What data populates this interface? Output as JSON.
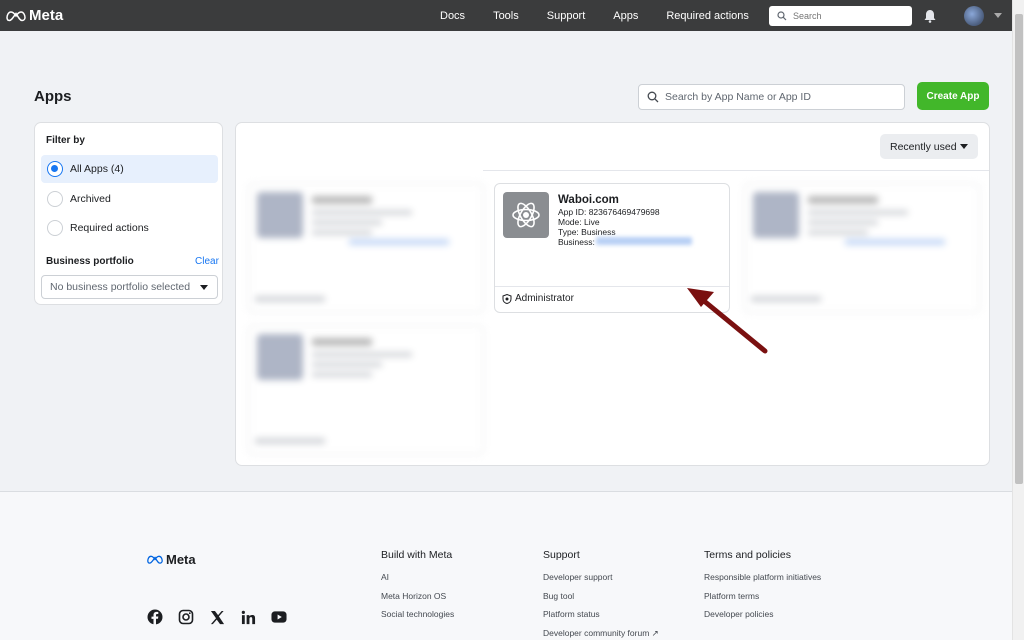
{
  "nav": {
    "brand": "Meta",
    "links": [
      "Docs",
      "Tools",
      "Support",
      "Apps",
      "Required actions"
    ],
    "search_placeholder": "Search"
  },
  "page": {
    "title": "Apps",
    "search_placeholder": "Search by App Name or App ID",
    "create_label": "Create App"
  },
  "filter": {
    "title": "Filter by",
    "options": [
      {
        "label": "All Apps (4)",
        "selected": true
      },
      {
        "label": "Archived",
        "selected": false
      },
      {
        "label": "Required actions",
        "selected": false
      }
    ],
    "portfolio_label": "Business portfolio",
    "clear_label": "Clear",
    "portfolio_value": "No business portfolio selected"
  },
  "apps": {
    "sort_label": "Recently used",
    "featured": {
      "name": "Waboi.com",
      "app_id": "App ID: 823676469479698",
      "mode": "Mode: Live",
      "type": "Type: Business",
      "business": "Business:",
      "role": "Administrator"
    }
  },
  "footer": {
    "brand": "Meta",
    "columns": [
      {
        "title": "Build with Meta",
        "links": [
          "AI",
          "Meta Horizon OS",
          "Social technologies"
        ]
      },
      {
        "title": "Support",
        "links": [
          "Developer support",
          "Bug tool",
          "Platform status",
          "Developer community forum ↗"
        ]
      },
      {
        "title": "Terms and policies",
        "links": [
          "Responsible platform initiatives",
          "Platform terms",
          "Developer policies"
        ]
      }
    ]
  },
  "colors": {
    "accent": "#1877f2",
    "create": "#42b72a",
    "nav": "#3b3c3d",
    "arrow": "#7a1010"
  }
}
